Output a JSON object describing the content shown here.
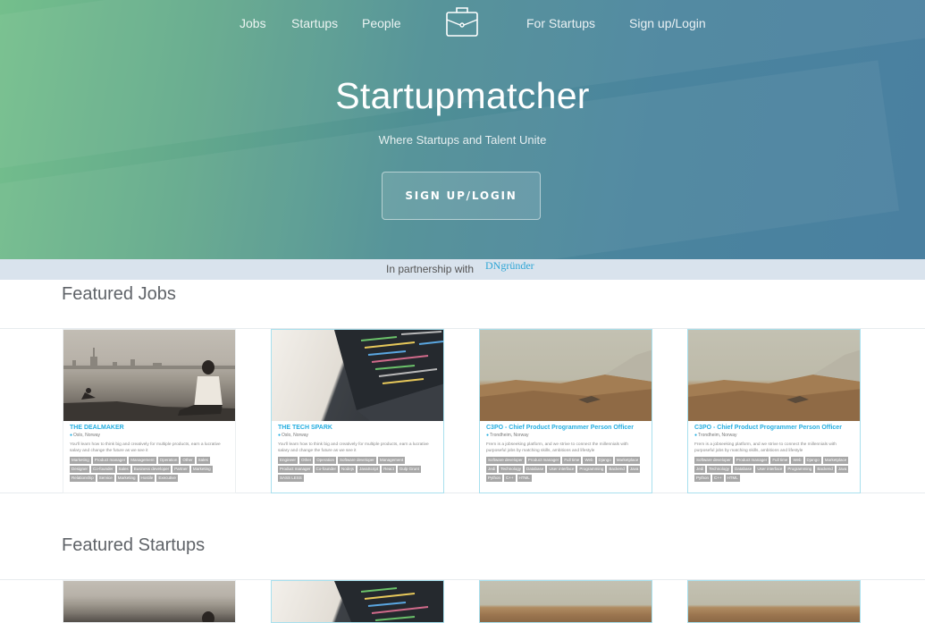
{
  "nav": {
    "jobs": "Jobs",
    "startups": "Startups",
    "people": "People",
    "for_startups": "For Startups",
    "signup": "Sign up/Login"
  },
  "hero": {
    "title": "Startupmatcher",
    "subtitle": "Where Startups and Talent Unite",
    "button": "SIGN UP/LOGIN"
  },
  "partnership": {
    "text": "In partnership with",
    "logo_text": "DNgründer"
  },
  "featured_jobs": {
    "title": "Featured Jobs",
    "cards": [
      {
        "title": "THE DEALMAKER",
        "location": "Oslo, Norway",
        "description": "You'll learn how to think big and creatively for multiple products, earn a lucrative salary and change the future as we see it",
        "tags": [
          "Marketing",
          "Product manager",
          "Management",
          "Operation",
          "Other",
          "Sales",
          "Designer",
          "Co-founder",
          "Sales",
          "Business developer",
          "Partner",
          "Marketing",
          "Relationship",
          "Service",
          "Marketing",
          "Hostile",
          "Executive"
        ]
      },
      {
        "title": "THE TECH SPARK",
        "location": "Oslo, Norway",
        "description": "You'll learn how to think big and creatively for multiple products, earn a lucrative salary and change the future as we see it",
        "tags": [
          "Engineer",
          "Other",
          "Operation",
          "Software developer",
          "Management",
          "Product manager",
          "Co-founder",
          "Nodejs",
          "JavaScript",
          "React",
          "Gulp Grunt",
          "SASS LESS"
        ]
      },
      {
        "title": "C3PO - Chief Product Programmer Person Officer",
        "location": "Trondheim, Norway",
        "description": "Frem is a jobseeking platform, and we strive to connect the millennials with purposeful jobs by matching skills, ambitions and lifestyle",
        "tags": [
          "Software developer",
          "Product manager",
          "Full time",
          "Web",
          "Django",
          "Marketplace",
          "Jedi",
          "Technology",
          "Database",
          "User interface",
          "Programming",
          "Backend",
          "Java",
          "Python",
          "C++",
          "HTML"
        ]
      },
      {
        "title": "C3PO - Chief Product Programmer Person Officer",
        "location": "Trondheim, Norway",
        "description": "Frem is a jobseeking platform, and we strive to connect the millennials with purposeful jobs by matching skills, ambitions and lifestyle",
        "tags": [
          "Software developer",
          "Product manager",
          "Full time",
          "Web",
          "Django",
          "Marketplace",
          "Jedi",
          "Technology",
          "Database",
          "User interface",
          "Programming",
          "Backend",
          "Java",
          "Python",
          "C++",
          "HTML"
        ]
      }
    ]
  },
  "featured_startups": {
    "title": "Featured Startups"
  },
  "colors": {
    "accent": "#25aee0",
    "tag_bg": "#a7a7a7",
    "hero_start": "#74bf8c",
    "hero_end": "#4a80a0"
  }
}
